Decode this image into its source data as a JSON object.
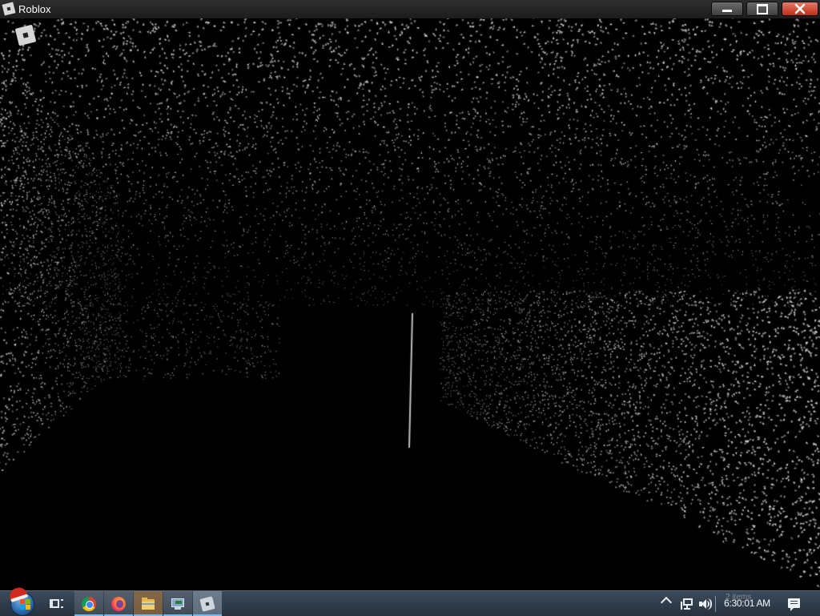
{
  "window": {
    "title": "Roblox",
    "controls": [
      "minimize",
      "maximize",
      "close"
    ],
    "close_color": "#c42b1c"
  },
  "viewport": {
    "background": "#000000",
    "particle_color": "#dcdcdc",
    "menu_icon": "roblox-logo-icon"
  },
  "taskbar": {
    "background": "#2d3a48",
    "items": [
      {
        "name": "start-button",
        "icon": "windows-start-orb-icon"
      },
      {
        "name": "task-view-button",
        "icon": "task-view-icon"
      },
      {
        "name": "chrome-button",
        "icon": "chrome-icon"
      },
      {
        "name": "firefox-button",
        "icon": "firefox-icon"
      },
      {
        "name": "file-explorer-button",
        "icon": "folder-icon"
      },
      {
        "name": "remote-desktop-button",
        "icon": "remote-desktop-icon"
      },
      {
        "name": "roblox-button",
        "icon": "roblox-icon"
      }
    ],
    "tray": {
      "show_hidden_icon": "chevron-up-icon",
      "network_icon": "network-icon",
      "volume_icon": "speaker-icon",
      "clock": "6:30:01 AM",
      "clock_overlay": "2 items",
      "notifications_icon": "action-center-icon"
    }
  }
}
